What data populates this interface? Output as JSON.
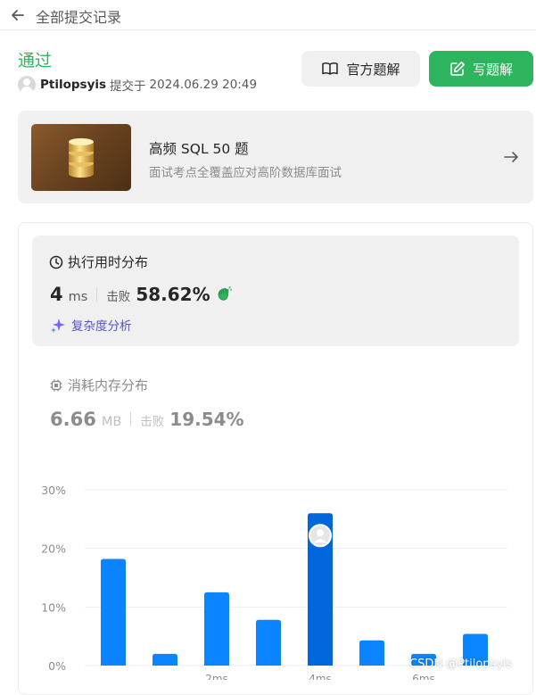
{
  "topbar": {
    "title": "全部提交记录"
  },
  "submission": {
    "status": "通过",
    "username": "Ptilopsyis",
    "submitted_label": "提交于",
    "timestamp": "2024.06.29 20:49"
  },
  "actions": {
    "official_solution_label": "官方题解",
    "write_solution_label": "写题解"
  },
  "promo": {
    "title": "高频 SQL 50 题",
    "subtitle": "面试考点全覆盖应对高阶数据库面试"
  },
  "runtime": {
    "heading": "执行用时分布",
    "value": "4",
    "unit": "ms",
    "beats_label": "击败",
    "beats_value": "58.62%",
    "complexity_label": "复杂度分析"
  },
  "memory": {
    "heading": "消耗内存分布",
    "value": "6.66",
    "unit": "MB",
    "beats_label": "击败",
    "beats_value": "19.54%"
  },
  "colors": {
    "accent_green": "#2db55d",
    "bar_blue": "#0a84ff",
    "bar_highlight": "#0066db",
    "purple": "#5a54c8"
  },
  "chart_data": {
    "type": "bar",
    "title": "",
    "xlabel": "",
    "ylabel": "",
    "ylim": [
      0,
      30
    ],
    "y_ticks": [
      "30%",
      "20%",
      "10%",
      "0%"
    ],
    "x_tick_labels": [
      "2ms",
      "4ms",
      "6ms"
    ],
    "values": [
      18.2,
      2.0,
      12.5,
      7.8,
      26.0,
      4.3,
      2.0,
      5.4
    ],
    "highlight_index": 4,
    "grid": true
  },
  "watermark": "CSDN @Ptilopsyis"
}
